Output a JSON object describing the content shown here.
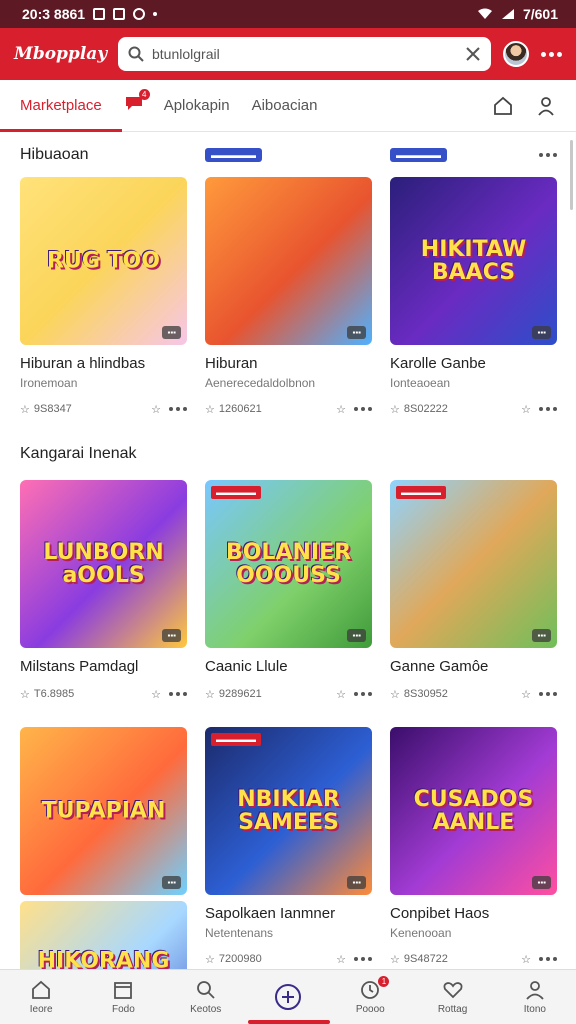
{
  "status_bar": {
    "time": "20:3 8861",
    "right_text": "7/601"
  },
  "header": {
    "brand": "Mbopplay",
    "search_value": "btunlolgrail"
  },
  "tabs": [
    {
      "label": "Marketplace",
      "active": true
    },
    {
      "label": "Aplokapin",
      "active": false
    },
    {
      "label": "Aiboacian",
      "active": false
    }
  ],
  "chat_badge": "4",
  "sections": [
    {
      "title": "Hibuaoan",
      "pills": [
        "",
        "▬▬▬▬▬",
        "▬▬▬▬▬"
      ],
      "cards": [
        {
          "art": "RUG TOO",
          "tag": "▪▪▪",
          "ribbon": "",
          "title": "Hiburan a hlindbas",
          "subtitle": "Ironemoan",
          "count": "9S8347",
          "bg": "linear-gradient(135deg,#ffe27a,#fbd55a 50%,#f6c6e8)"
        },
        {
          "art": "",
          "tag": "▪▪▪",
          "ribbon": "",
          "title": "Hiburan",
          "subtitle": "Aenerecedaldolbnon",
          "count": "1260621",
          "bg": "linear-gradient(135deg,#ff9a3c,#e8542f 55%,#4fb1ff)"
        },
        {
          "art": "HIKITAW BAACS",
          "tag": "▪▪▪",
          "ribbon": "",
          "title": "Karolle Ganbe",
          "subtitle": "Ionteaoean",
          "count": "8S02222",
          "bg": "linear-gradient(135deg,#2b1f7a,#6a2bc2 55%,#2d4ec9)"
        }
      ]
    },
    {
      "title": "Kangarai Inenak",
      "pills": [
        "",
        "",
        ""
      ],
      "cards": [
        {
          "art": "LUNBORN aOOLS",
          "tag": "▪▪▪",
          "ribbon": "",
          "title": "Milstans Pamdagl",
          "subtitle": "",
          "count": "T6.8985",
          "bg": "linear-gradient(135deg,#ff6fb3,#8a3ce0 55%,#ffc83d)"
        },
        {
          "art": "BOLANIER OOOUSS",
          "tag": "▪▪▪",
          "ribbon": "▬▬▬▬▬",
          "title": "Caanic Llule",
          "subtitle": "",
          "count": "9289621",
          "bg": "linear-gradient(135deg,#79c7ff,#7fd06a 60%,#3f9b3a)"
        },
        {
          "art": "",
          "tag": "▪▪▪",
          "ribbon": "▬▬▬▬▬",
          "title": "Ganne Gamôe",
          "subtitle": "",
          "count": "8S30952",
          "bg": "linear-gradient(135deg,#8fd3ff,#e0a85a 50%,#6fbf5a)"
        }
      ]
    },
    {
      "title": "",
      "pills": [
        "",
        "",
        ""
      ],
      "cards": [
        {
          "art": "TUPAPIAN",
          "tag": "▪▪▪",
          "ribbon": "",
          "title": "",
          "subtitle": "",
          "count": "",
          "bg": "linear-gradient(135deg,#ffb54a,#ff6a3c 55%,#6fd0ff)"
        },
        {
          "art": "NBIKIAR SAMEES",
          "tag": "▪▪▪",
          "ribbon": "▬▬▬▬▬",
          "title": "Sapolkaen Ianmner",
          "subtitle": "Netentenans",
          "count": "7200980",
          "bg": "linear-gradient(135deg,#1c2a6b,#2d5fd4 55%,#ff8b3a)"
        },
        {
          "art": "CUSADOS AANLE",
          "tag": "▪▪▪",
          "ribbon": "",
          "title": "Conpibet Haos",
          "subtitle": "Kenenooan",
          "count": "9S48722",
          "bg": "linear-gradient(135deg,#3a0e6b,#a23bd4 55%,#ff4fa0)"
        }
      ]
    }
  ],
  "extra_thumb": {
    "art": "HIKORANG",
    "bg": "linear-gradient(135deg,#ffe08a,#a8d8ff 60%,#5b7bd6)"
  },
  "bottom_nav": [
    {
      "label": "Ieore",
      "icon": "home-icon"
    },
    {
      "label": "Fodo",
      "icon": "calendar-icon"
    },
    {
      "label": "Keotos",
      "icon": "search-icon"
    },
    {
      "label": "",
      "icon": "plus-circle-icon"
    },
    {
      "label": "Poooo",
      "icon": "clock-icon",
      "badge": "1"
    },
    {
      "label": "Rottag",
      "icon": "heart-icon"
    },
    {
      "label": "Itono",
      "icon": "user-icon"
    }
  ],
  "colors": {
    "primary": "#d71f2e",
    "status_bar": "#5e1a24",
    "pill": "#3650c8"
  }
}
